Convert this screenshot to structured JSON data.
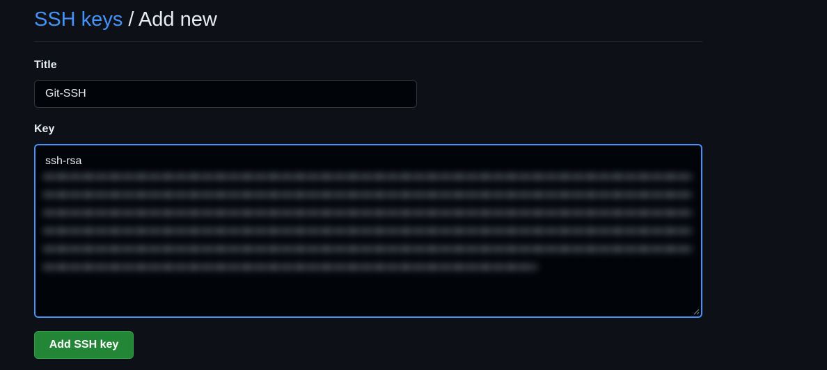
{
  "breadcrumb": {
    "parent_label": "SSH keys",
    "separator": "/",
    "current_label": "Add new"
  },
  "form": {
    "title_label": "Title",
    "title_value": "Git-SSH",
    "key_label": "Key",
    "key_visible_prefix": "ssh-rsa",
    "submit_label": "Add SSH key"
  },
  "colors": {
    "background": "#0d1117",
    "link": "#4493f8",
    "focus_border": "#4493f8",
    "button_green": "#238636",
    "text": "#e6edf3"
  }
}
